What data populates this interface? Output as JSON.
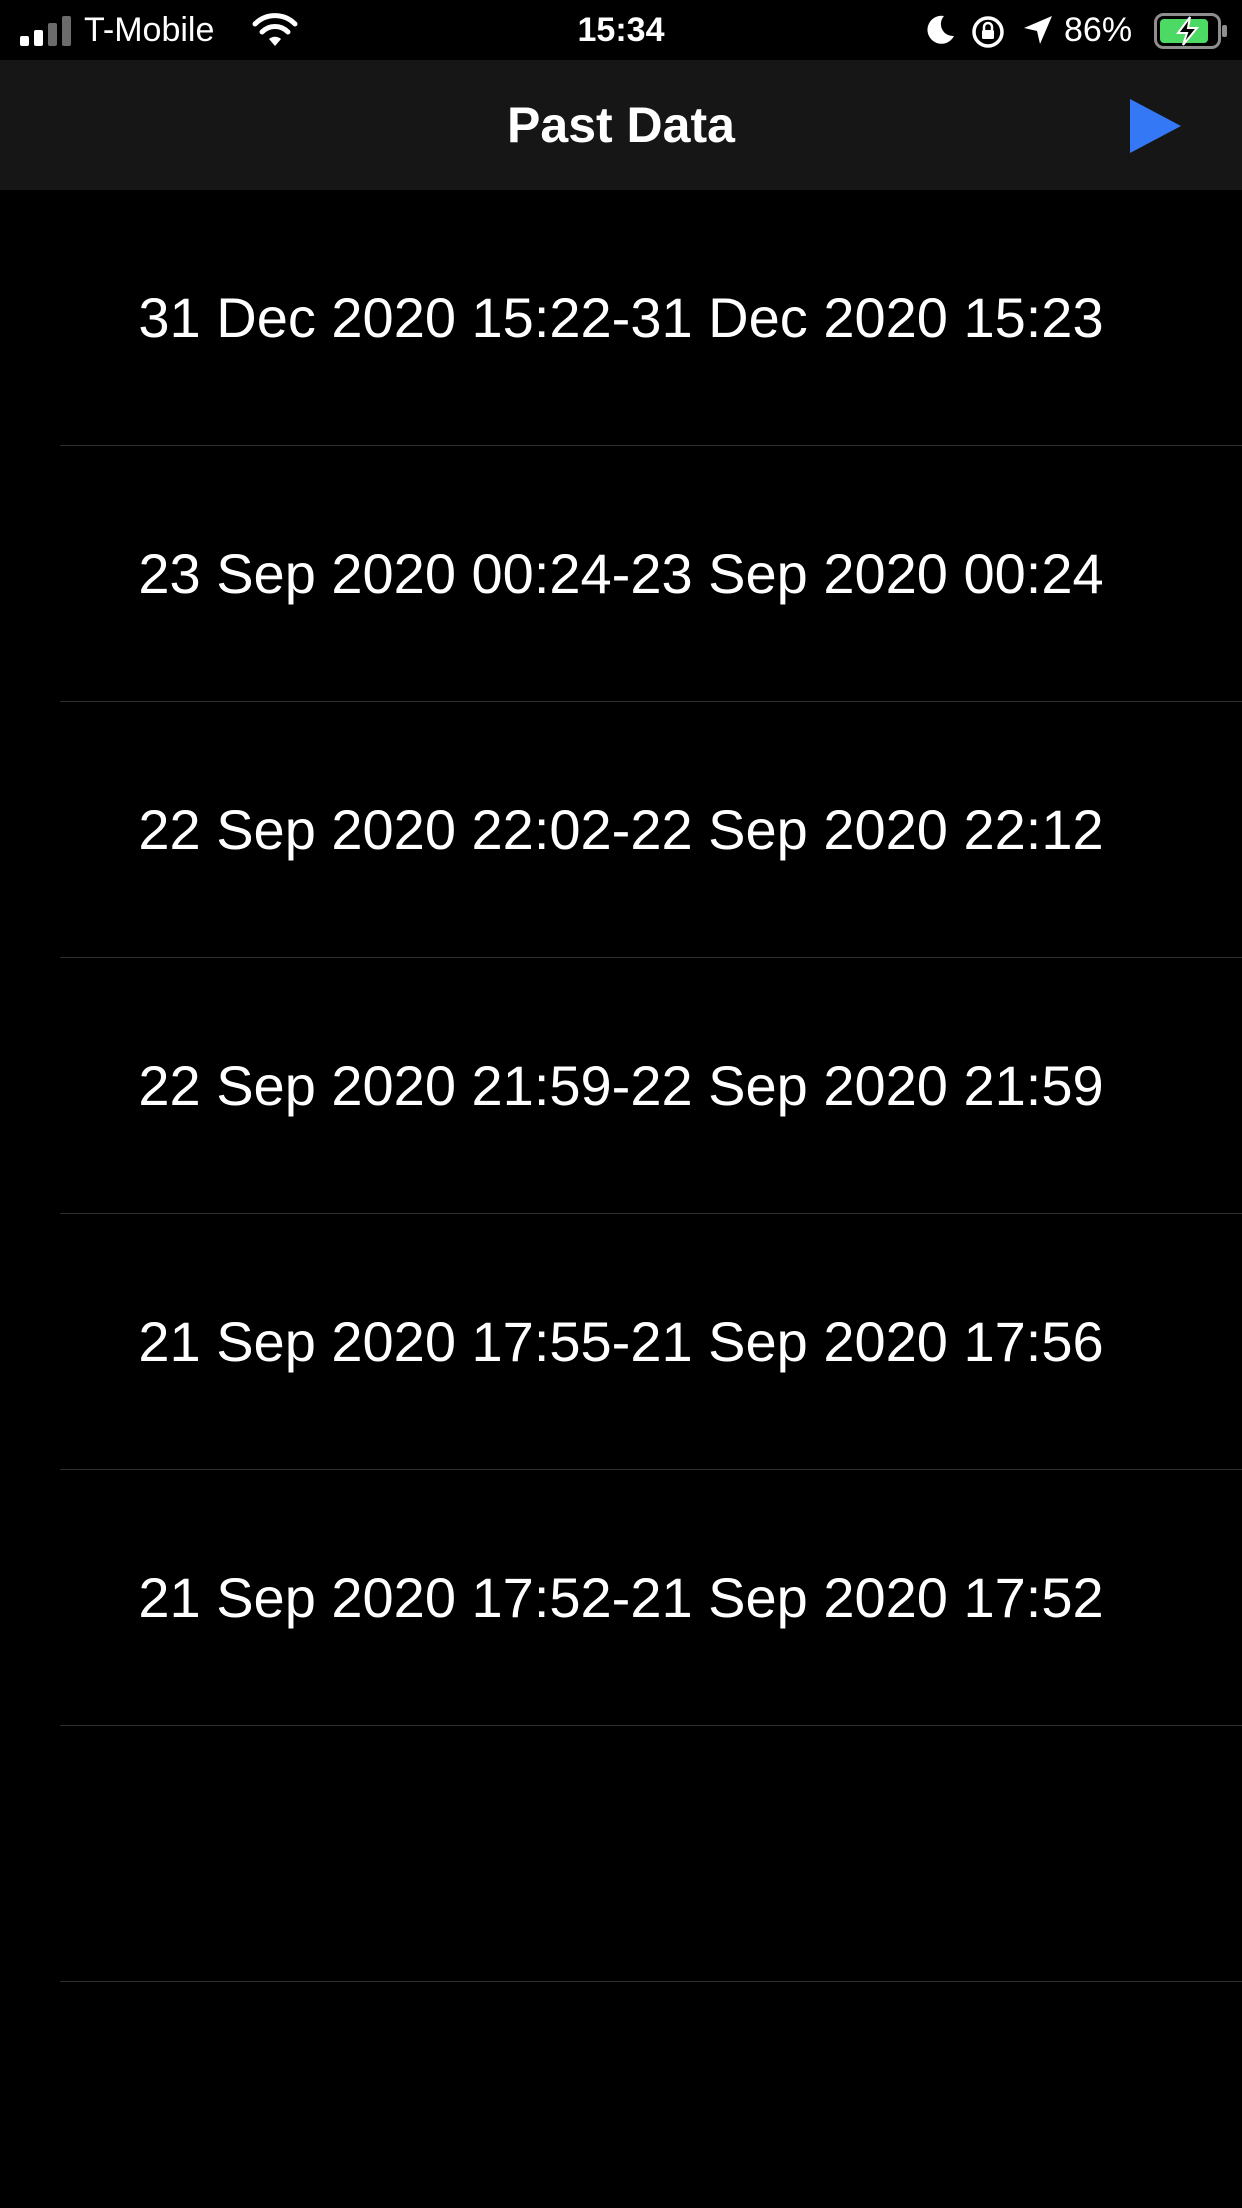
{
  "status_bar": {
    "carrier": "T-Mobile",
    "time": "15:34",
    "battery_percent": "86%",
    "icons": [
      "signal-icon",
      "wifi-icon",
      "moon-icon",
      "orientation-lock-icon",
      "location-icon",
      "battery-icon"
    ]
  },
  "nav": {
    "title": "Past Data",
    "play_icon": "play-icon",
    "accent_color": "#3478f6"
  },
  "list": {
    "items": [
      {
        "label": "31 Dec 2020 15:22-31 Dec 2020 15:23"
      },
      {
        "label": "23 Sep 2020 00:24-23 Sep 2020 00:24"
      },
      {
        "label": "22 Sep 2020 22:02-22 Sep 2020 22:12"
      },
      {
        "label": "22 Sep 2020 21:59-22 Sep 2020 21:59"
      },
      {
        "label": "21 Sep 2020 17:55-21 Sep 2020 17:56"
      },
      {
        "label": "21 Sep 2020 17:52-21 Sep 2020 17:52"
      },
      {
        "label": ""
      }
    ]
  },
  "colors": {
    "background": "#000000",
    "nav_background": "#161616",
    "separator": "#2c2c2e",
    "battery_fill": "#4cd964"
  }
}
